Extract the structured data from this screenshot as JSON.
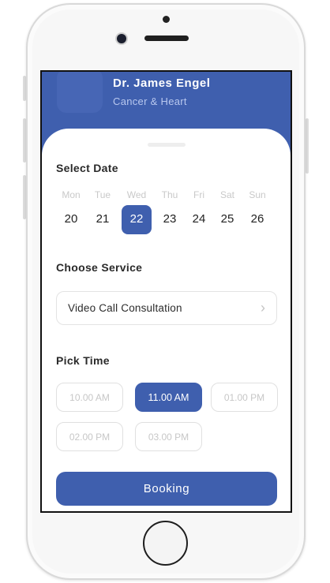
{
  "header": {
    "doctor_name": "Dr. James Engel",
    "specialty": "Cancer & Heart"
  },
  "select_date": {
    "title": "Select Date",
    "days": [
      {
        "name": "Mon",
        "num": "20"
      },
      {
        "name": "Tue",
        "num": "21"
      },
      {
        "name": "Wed",
        "num": "22"
      },
      {
        "name": "Thu",
        "num": "23"
      },
      {
        "name": "Fri",
        "num": "24"
      },
      {
        "name": "Sat",
        "num": "25"
      },
      {
        "name": "Sun",
        "num": "26"
      }
    ],
    "selected": "22"
  },
  "choose_service": {
    "title": "Choose Service",
    "value": "Video Call Consultation"
  },
  "pick_time": {
    "title": "Pick Time",
    "times": [
      "10.00 AM",
      "11.00 AM",
      "01.00 PM",
      "02.00 PM",
      "03.00 PM"
    ],
    "selected": "11.00 AM"
  },
  "booking": {
    "label": "Booking"
  },
  "colors": {
    "primary": "#3f5fae",
    "text": "#2a2a2a",
    "muted": "#c7c7c7"
  }
}
